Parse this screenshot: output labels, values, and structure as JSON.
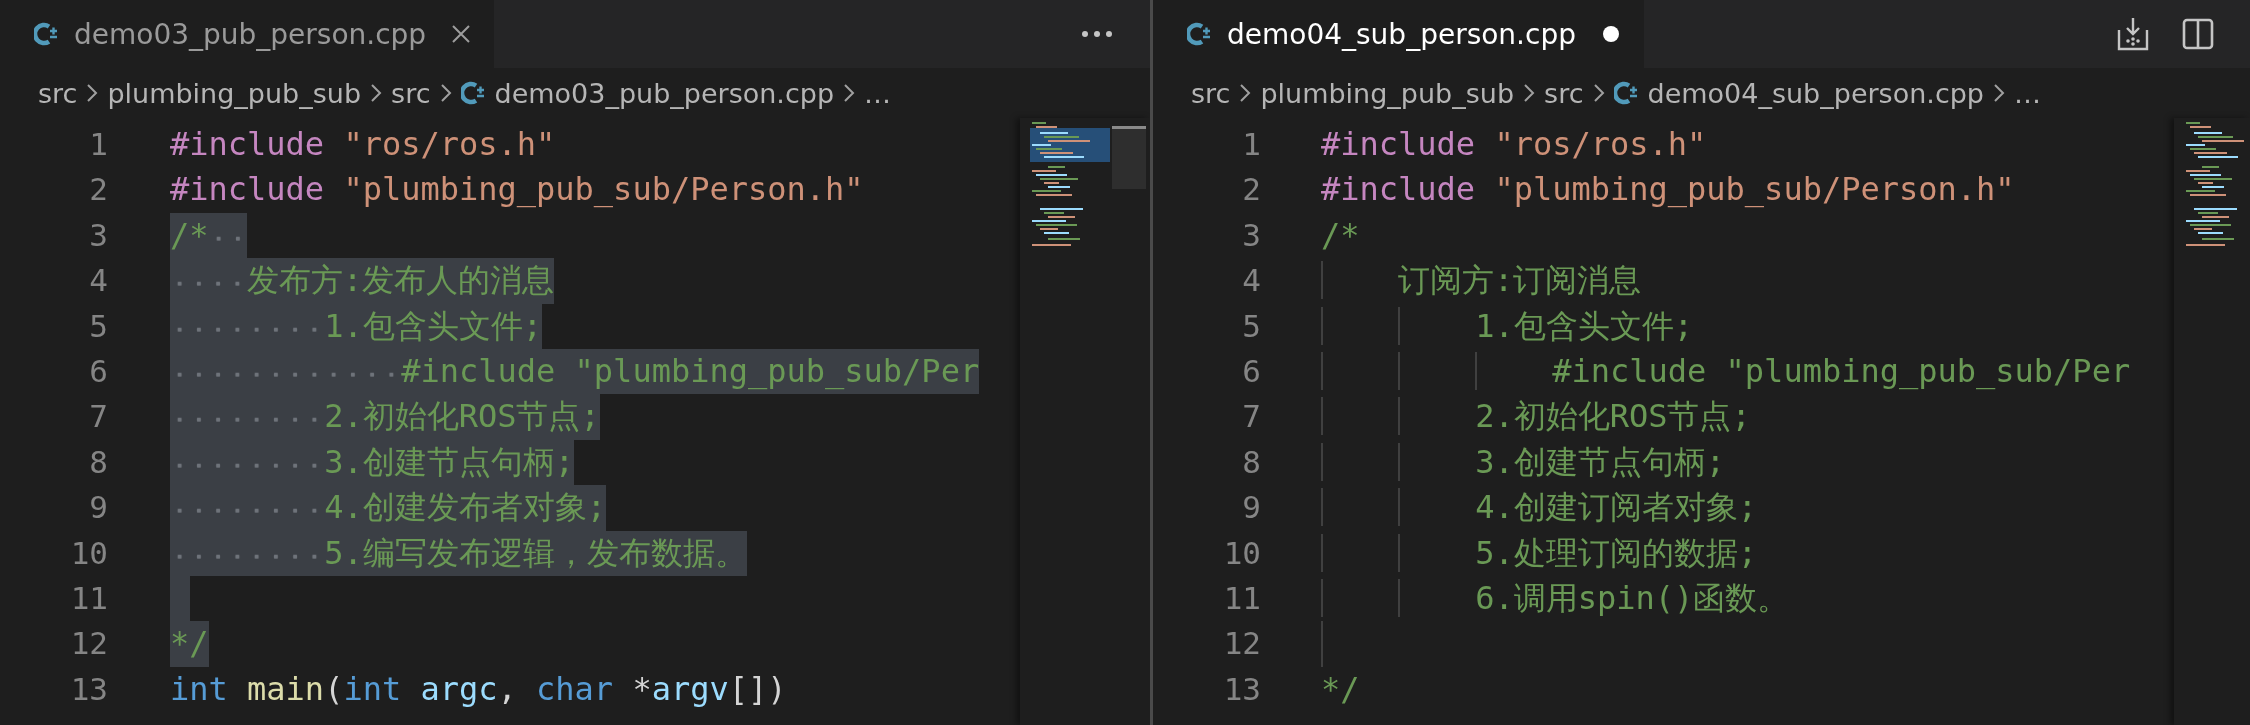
{
  "editors": [
    {
      "tab": {
        "label": "demo03_pub_person.cpp",
        "dirty": false
      },
      "actions": [
        {
          "kind": "more"
        }
      ],
      "breadcrumbs": [
        {
          "label": "src",
          "kind": "folder"
        },
        {
          "label": "plumbing_pub_sub",
          "kind": "folder"
        },
        {
          "label": "src",
          "kind": "folder"
        },
        {
          "label": "demo03_pub_person.cpp",
          "kind": "file"
        },
        {
          "label": "…",
          "kind": "folder"
        }
      ],
      "indent_guides": false,
      "lines": [
        {
          "number": "1",
          "selected": false,
          "tokens": [
            {
              "kind": "preproc",
              "text": "#include"
            },
            {
              "kind": "string",
              "text": " \"ros/ros.h\""
            }
          ]
        },
        {
          "number": "2",
          "selected": false,
          "tokens": [
            {
              "kind": "preproc",
              "text": "#include"
            },
            {
              "kind": "string",
              "text": " \"plumbing_pub_sub/Person.h\""
            }
          ]
        },
        {
          "number": "3",
          "selected": true,
          "tokens": [
            {
              "kind": "comment",
              "text": "/*  "
            }
          ]
        },
        {
          "number": "4",
          "selected": true,
          "tokens": [
            {
              "kind": "comment",
              "text": "    发布方:发布人的消息"
            }
          ]
        },
        {
          "number": "5",
          "selected": true,
          "tokens": [
            {
              "kind": "comment",
              "text": "        1.包含头文件;"
            }
          ]
        },
        {
          "number": "6",
          "selected": true,
          "tokens": [
            {
              "kind": "comment",
              "text": "            #include \"plumbing_pub_sub/Per"
            }
          ]
        },
        {
          "number": "7",
          "selected": true,
          "tokens": [
            {
              "kind": "comment",
              "text": "        2.初始化ROS节点;"
            }
          ]
        },
        {
          "number": "8",
          "selected": true,
          "tokens": [
            {
              "kind": "comment",
              "text": "        3.创建节点句柄;"
            }
          ]
        },
        {
          "number": "9",
          "selected": true,
          "tokens": [
            {
              "kind": "comment",
              "text": "        4.创建发布者对象;"
            }
          ]
        },
        {
          "number": "10",
          "selected": true,
          "tokens": [
            {
              "kind": "comment",
              "text": "        5.编写发布逻辑，发布数据。"
            }
          ]
        },
        {
          "number": "11",
          "selected": true
        },
        {
          "number": "12",
          "selected": true,
          "tokens": [
            {
              "kind": "comment",
              "text": "*/"
            }
          ]
        },
        {
          "number": "13",
          "selected": false,
          "tokens": [
            {
              "kind": "keyword",
              "text": "int"
            },
            {
              "kind": "function",
              "text": " main"
            },
            {
              "kind": "plain",
              "text": "("
            },
            {
              "kind": "keyword",
              "text": "int"
            },
            {
              "kind": "variable",
              "text": " argc"
            },
            {
              "kind": "plain",
              "text": ", "
            },
            {
              "kind": "keyword",
              "text": "char"
            },
            {
              "kind": "plain",
              "text": " *"
            },
            {
              "kind": "variable",
              "text": "argv"
            },
            {
              "kind": "plain",
              "text": "[])"
            }
          ]
        }
      ]
    },
    {
      "tab": {
        "label": "demo04_sub_person.cpp",
        "dirty": true
      },
      "actions": [
        {
          "kind": "compare"
        },
        {
          "kind": "split"
        }
      ],
      "breadcrumbs": [
        {
          "label": "src",
          "kind": "folder"
        },
        {
          "label": "plumbing_pub_sub",
          "kind": "folder"
        },
        {
          "label": "src",
          "kind": "folder"
        },
        {
          "label": "demo04_sub_person.cpp",
          "kind": "file"
        },
        {
          "label": "…",
          "kind": "folder"
        }
      ],
      "indent_guides": true,
      "lines": [
        {
          "number": "1",
          "selected": false,
          "tokens": [
            {
              "kind": "preproc",
              "text": "#include"
            },
            {
              "kind": "string",
              "text": " \"ros/ros.h\""
            }
          ]
        },
        {
          "number": "2",
          "selected": false,
          "tokens": [
            {
              "kind": "preproc",
              "text": "#include"
            },
            {
              "kind": "string",
              "text": " \"plumbing_pub_sub/Person.h\""
            }
          ]
        },
        {
          "number": "3",
          "selected": false,
          "tokens": [
            {
              "kind": "comment",
              "text": "/*"
            }
          ]
        },
        {
          "number": "4",
          "selected": false,
          "tokens": [
            {
              "kind": "comment",
              "text": "    订阅方:订阅消息"
            }
          ]
        },
        {
          "number": "5",
          "selected": false,
          "tokens": [
            {
              "kind": "comment",
              "text": "        1.包含头文件;"
            }
          ]
        },
        {
          "number": "6",
          "selected": false,
          "tokens": [
            {
              "kind": "comment",
              "text": "            #include \"plumbing_pub_sub/Per"
            }
          ]
        },
        {
          "number": "7",
          "selected": false,
          "tokens": [
            {
              "kind": "comment",
              "text": "        2.初始化ROS节点;"
            }
          ]
        },
        {
          "number": "8",
          "selected": false,
          "tokens": [
            {
              "kind": "comment",
              "text": "        3.创建节点句柄;"
            }
          ]
        },
        {
          "number": "9",
          "selected": false,
          "tokens": [
            {
              "kind": "comment",
              "text": "        4.创建订阅者对象;"
            }
          ]
        },
        {
          "number": "10",
          "selected": false,
          "tokens": [
            {
              "kind": "comment",
              "text": "        5.处理订阅的数据;"
            }
          ]
        },
        {
          "number": "11",
          "selected": false,
          "tokens": [
            {
              "kind": "comment",
              "text": "        6.调用spin()函数。"
            }
          ]
        },
        {
          "number": "12",
          "selected": false
        },
        {
          "number": "13",
          "selected": false,
          "tokens": [
            {
              "kind": "comment",
              "text": "*/"
            }
          ]
        }
      ]
    }
  ]
}
